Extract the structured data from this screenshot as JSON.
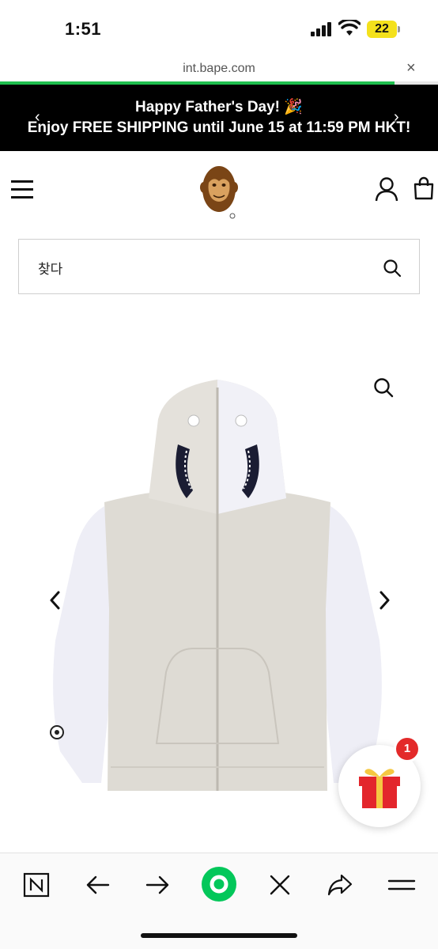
{
  "status_bar": {
    "time": "1:51",
    "battery_level": "22"
  },
  "browser": {
    "url": "int.bape.com",
    "close_glyph": "×",
    "load_progress_percent": 90
  },
  "promo_banner": {
    "line1": "Happy Father's Day! 🎉",
    "line2": "Enjoy FREE SHIPPING until June 15 at 11:59 PM HKT!",
    "prev_glyph": "‹",
    "next_glyph": "›"
  },
  "header": {
    "menu_icon": "hamburger-icon",
    "logo_icon": "ape-head-logo",
    "account_icon": "account-icon",
    "bag_icon": "shopping-bag-icon"
  },
  "search": {
    "placeholder": "찾다",
    "icon": "search-icon"
  },
  "product": {
    "zoom_icon": "zoom-icon",
    "prev_icon": "chevron-left-icon",
    "next_icon": "chevron-right-icon"
  },
  "gift_widget": {
    "badge_count": "1",
    "icon": "gift-icon"
  },
  "toolbar": {
    "items": [
      "naver-n-icon",
      "back-icon",
      "forward-icon",
      "green-home-icon",
      "close-icon",
      "share-icon",
      "menu-icon"
    ]
  },
  "colors": {
    "banner_bg": "#000000",
    "progress": "#1fbf4e",
    "battery": "#f4e11c",
    "badge": "#e32a2a",
    "toolbar_accent": "#03c75a"
  }
}
